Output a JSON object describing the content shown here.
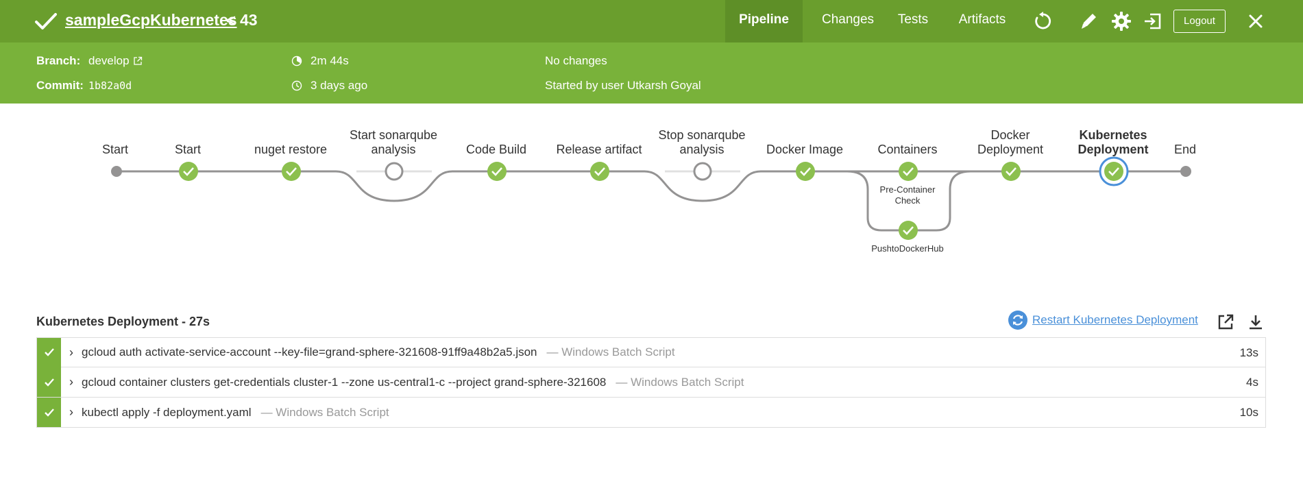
{
  "header": {
    "job_name": "sampleGcpKubernetes",
    "run_separator": "<",
    "run_number": "43",
    "tabs": [
      "Pipeline",
      "Changes",
      "Tests",
      "Artifacts"
    ],
    "logout_label": "Logout",
    "icons": [
      "check-icon",
      "replay-icon",
      "edit-icon",
      "gear-icon",
      "exit-icon",
      "close-icon"
    ],
    "colors": {
      "header_bg": "#6a9e2d",
      "active_tab_bg": "#5e8f27",
      "meta_bg": "#79b23a"
    }
  },
  "meta": {
    "branch_label": "Branch:",
    "branch_value": "develop",
    "commit_label": "Commit:",
    "commit_value": "1b82a0d",
    "duration": "2m 44s",
    "time_ago": "3 days ago",
    "changes": "No changes",
    "started_by": "Started by user Utkarsh Goyal"
  },
  "pipeline": {
    "stages": [
      {
        "label": "Start",
        "state": "start-node"
      },
      {
        "label": "Start",
        "state": "success"
      },
      {
        "label": "nuget restore",
        "state": "success"
      },
      {
        "label": "Start sonarqube analysis",
        "state": "skipped"
      },
      {
        "label": "Code Build",
        "state": "success"
      },
      {
        "label": "Release artifact",
        "state": "success"
      },
      {
        "label": "Stop sonarqube analysis",
        "state": "skipped"
      },
      {
        "label": "Docker Image",
        "state": "success"
      },
      {
        "label": "Containers",
        "state": "success"
      },
      {
        "label": "Docker Deployment",
        "state": "success"
      },
      {
        "label": "Kubernetes Deployment",
        "state": "success-selected"
      },
      {
        "label": "End",
        "state": "end-node"
      }
    ],
    "parallel_branches": [
      "Pre-Container Check",
      "PushtoDockerHub"
    ],
    "colors": {
      "success": "#8cc04f",
      "selected_ring": "#4a90d9",
      "line": "#949393",
      "skipped_line": "#e0e0e0"
    }
  },
  "steps_panel": {
    "title": "Kubernetes Deployment - 27s",
    "restart_label": "Restart Kubernetes Deployment",
    "steps": [
      {
        "command": "gcloud auth activate-service-account --key-file=grand-sphere-321608-91ff9a48b2a5.json",
        "type": "— Windows Batch Script",
        "duration": "13s"
      },
      {
        "command": "gcloud container clusters get-credentials cluster-1 --zone us-central1-c --project grand-sphere-321608",
        "type": "— Windows Batch Script",
        "duration": "4s"
      },
      {
        "command": "kubectl apply -f deployment.yaml",
        "type": "— Windows Batch Script",
        "duration": "10s"
      }
    ]
  }
}
